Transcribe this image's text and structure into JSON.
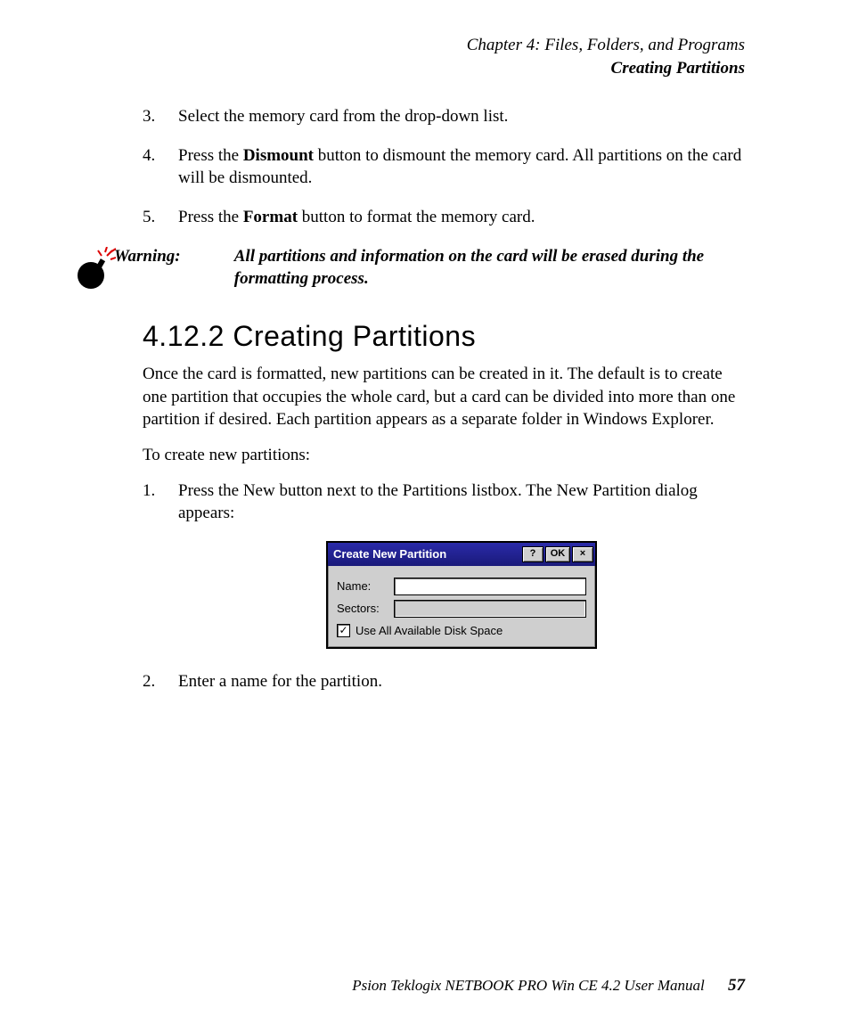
{
  "header": {
    "chapter": "Chapter 4:  Files, Folders, and Programs",
    "section": "Creating Partitions"
  },
  "steps_a": {
    "s3_num": "3.",
    "s3_text": "Select the memory card from the drop-down list.",
    "s4_num": "4.",
    "s4_pre": "Press the ",
    "s4_bold": "Dismount",
    "s4_post": " button to dismount the memory card. All partitions on the card will be dismounted.",
    "s5_num": "5.",
    "s5_pre": "Press the ",
    "s5_bold": "Format",
    "s5_post": " button to format the memory card."
  },
  "warning": {
    "label": "Warning:",
    "body": "All partitions and information on the card will be erased during the formatting process."
  },
  "heading": "4.12.2   Creating Partitions",
  "para1": "Once the card is formatted, new partitions can be created in it. The default is to create one partition that occupies the whole card, but a card can be divided into more than one partition if desired. Each partition appears as a separate folder in Windows Explorer.",
  "para2": "To create new partitions:",
  "steps_b": {
    "s1_num": "1.",
    "s1_text": "Press the New button next to the Partitions listbox. The New Partition dialog appears:",
    "s2_num": "2.",
    "s2_text": "Enter a name for the partition."
  },
  "dialog": {
    "title": "Create New Partition",
    "help": "?",
    "ok": "OK",
    "close": "×",
    "name_label": "Name:",
    "name_value": "",
    "sectors_label": "Sectors:",
    "sectors_value": "",
    "checkbox_checked": "✓",
    "checkbox_label": "Use All Available Disk Space"
  },
  "footer": {
    "manual": "Psion Teklogix NETBOOK PRO Win CE 4.2 User Manual",
    "page": "57"
  }
}
